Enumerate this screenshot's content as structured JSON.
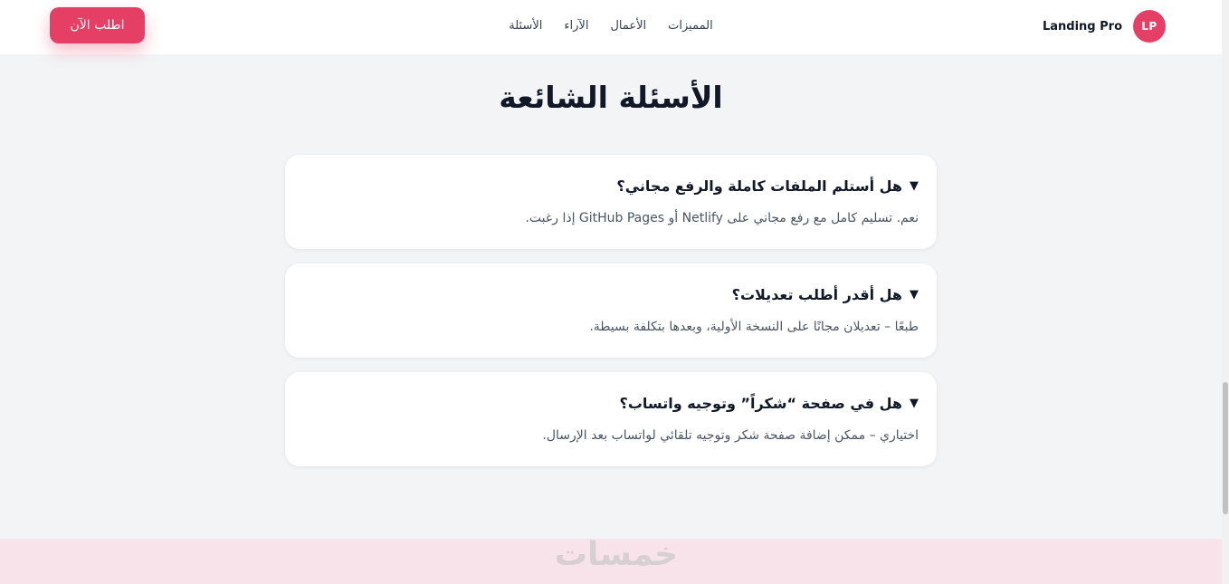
{
  "header": {
    "logo_initials": "LP",
    "brand_name": "Landing Pro",
    "nav": [
      "المميزات",
      "الأعمال",
      "الآراء",
      "الأسئلة"
    ],
    "cta_label": "اطلب الآن"
  },
  "main": {
    "title": "الأسئلة الشائعة",
    "faq": [
      {
        "q": "هل أستلم الملفات كاملة والرفع مجاني؟",
        "a": "نعم. تسليم كامل مع رفع مجاني على Netlify أو GitHub Pages إذا رغبت."
      },
      {
        "q": "هل أقدر أطلب تعديلات؟",
        "a": "طبعًا – تعديلان مجانًا على النسخة الأولية، وبعدها بتكلفة بسيطة."
      },
      {
        "q": "هل في صفحة “شكراً” وتوجيه واتساب؟",
        "a": "اختياري – ممكن إضافة صفحة شكر وتوجيه تلقائي لواتساب بعد الإرسال."
      }
    ]
  },
  "watermark": "خمسات",
  "colors": {
    "accent": "#e63f66",
    "background": "#f3f4f6"
  },
  "icons": {
    "faq_toggle": "triangle-down-icon"
  }
}
